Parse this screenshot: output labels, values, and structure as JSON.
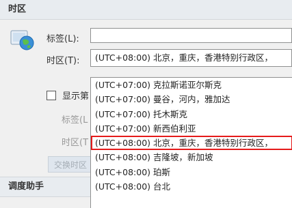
{
  "sections": {
    "timezone_title": "时区",
    "scheduler_title": "调度助手"
  },
  "form": {
    "label_caption": "标签(L):",
    "timezone_caption": "时区(T):",
    "timezone_value": "(UTC+08:00) 北京，重庆，香港特别行政区，",
    "show_second_caption": "显示第",
    "label2_caption": "标签(L",
    "timezone2_caption": "时区(T",
    "swap_button": "交换时区"
  },
  "dropdown": {
    "items": [
      "(UTC+07:00) 克拉斯诺亚尔斯克",
      "(UTC+07:00) 曼谷，河内，雅加达",
      "(UTC+07:00) 托木斯克",
      "(UTC+07:00) 新西伯利亚",
      "(UTC+08:00) 北京，重庆，香港特别行政区，",
      "(UTC+08:00) 吉隆坡，新加坡",
      "(UTC+08:00) 珀斯",
      "(UTC+08:00) 台北"
    ],
    "selected_index": 4
  }
}
